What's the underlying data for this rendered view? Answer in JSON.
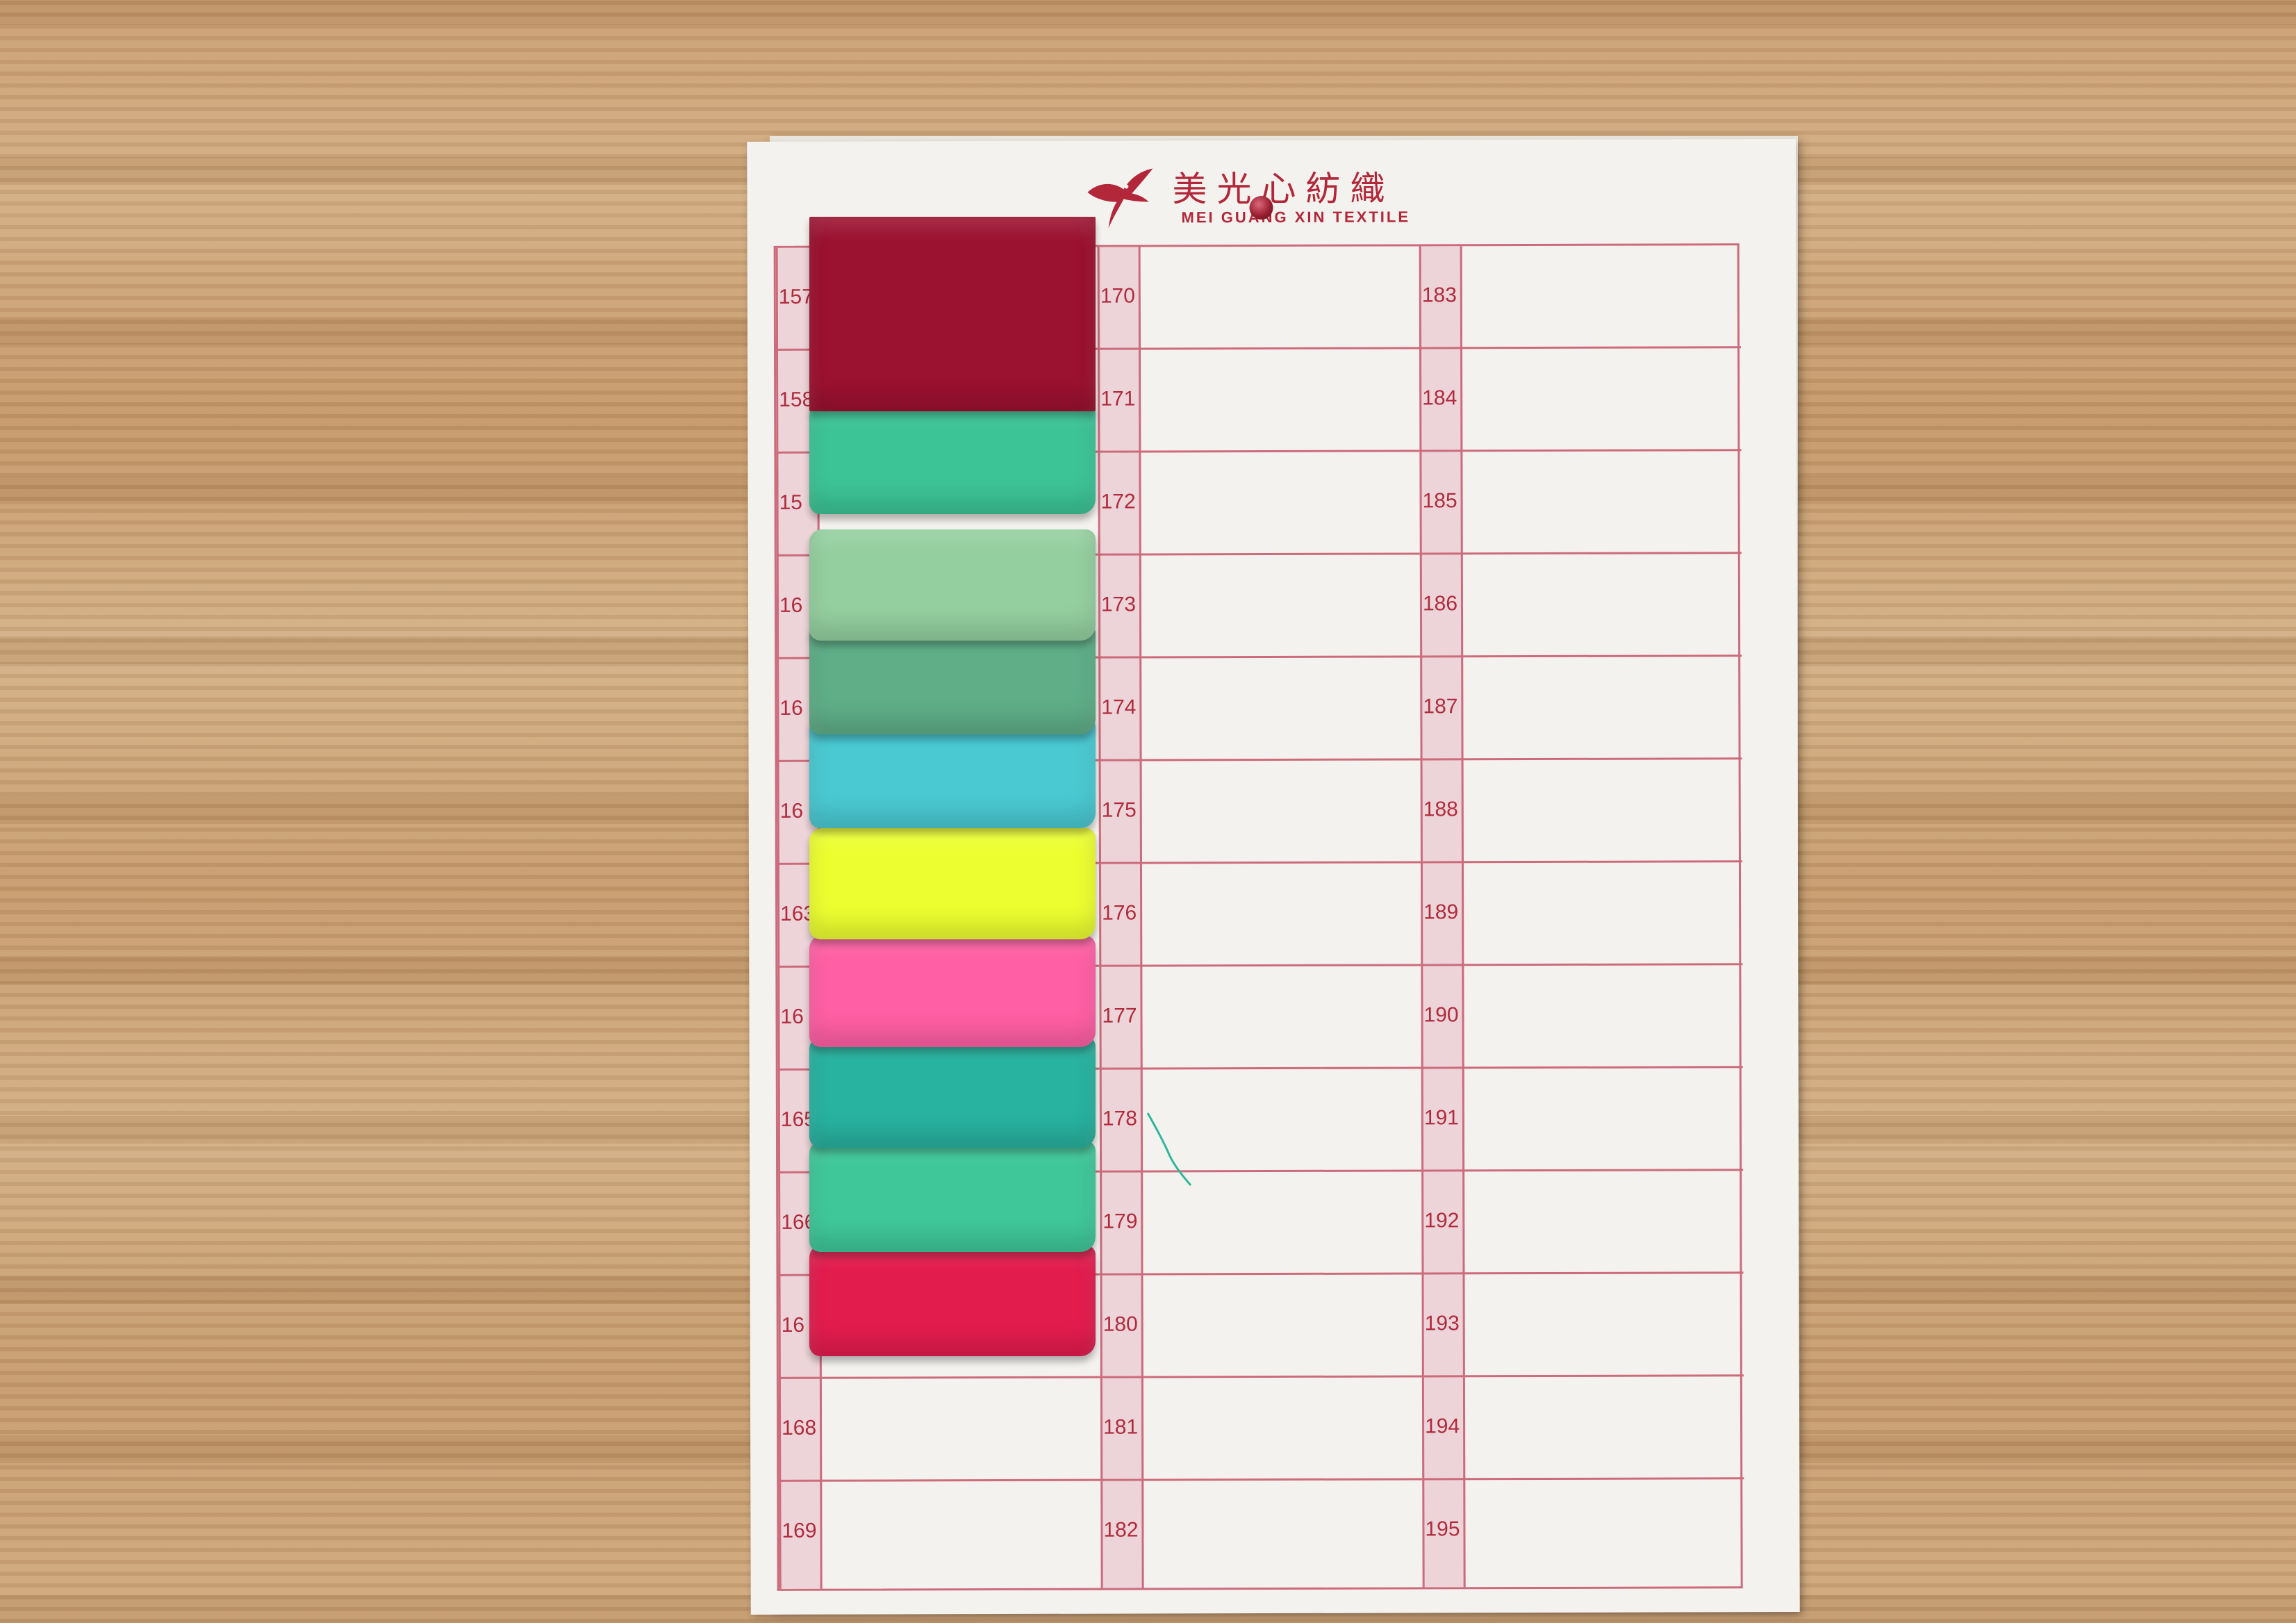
{
  "brand": {
    "name_cn": "美光心紡織",
    "name_en": "MEI GUANG XIN TEXTILE"
  },
  "color_card": {
    "columns": [
      {
        "numbers": [
          "157",
          "158",
          "159",
          "160",
          "161",
          "162",
          "163",
          "164",
          "165",
          "166",
          "167",
          "168",
          "169"
        ]
      },
      {
        "numbers": [
          "170",
          "171",
          "172",
          "173",
          "174",
          "175",
          "176",
          "177",
          "178",
          "179",
          "180",
          "181",
          "182"
        ]
      },
      {
        "numbers": [
          "183",
          "184",
          "185",
          "186",
          "187",
          "188",
          "189",
          "190",
          "191",
          "192",
          "193",
          "194",
          "195"
        ]
      }
    ],
    "visible_numbers_col1": [
      "157",
      "158",
      "15",
      "16",
      "16",
      "16",
      "163",
      "16",
      "165",
      "166",
      "16",
      "168",
      "169"
    ]
  },
  "swatches": [
    {
      "color": "#9b1130",
      "name": "burgundy-swatch"
    },
    {
      "color": "#3dc496",
      "name": "mint-green-swatch"
    },
    {
      "color": "#94cf9f",
      "name": "sage-green-swatch"
    },
    {
      "color": "#5fae88",
      "name": "grey-green-swatch"
    },
    {
      "color": "#4ac9d2",
      "name": "aqua-swatch"
    },
    {
      "color": "#ecfe30",
      "name": "neon-yellow-swatch"
    },
    {
      "color": "#ff5fa4",
      "name": "neon-pink-swatch"
    },
    {
      "color": "#28b2a0",
      "name": "teal-swatch"
    },
    {
      "color": "#3fc79a",
      "name": "jade-swatch"
    },
    {
      "color": "#e31c4e",
      "name": "red-swatch"
    }
  ],
  "colors": {
    "grid_line": "#cc6b7c",
    "number_strip": "#ecd4d8",
    "number_text": "#b12a3d",
    "board": "#f4f2ee",
    "wood": "#c89d72"
  }
}
